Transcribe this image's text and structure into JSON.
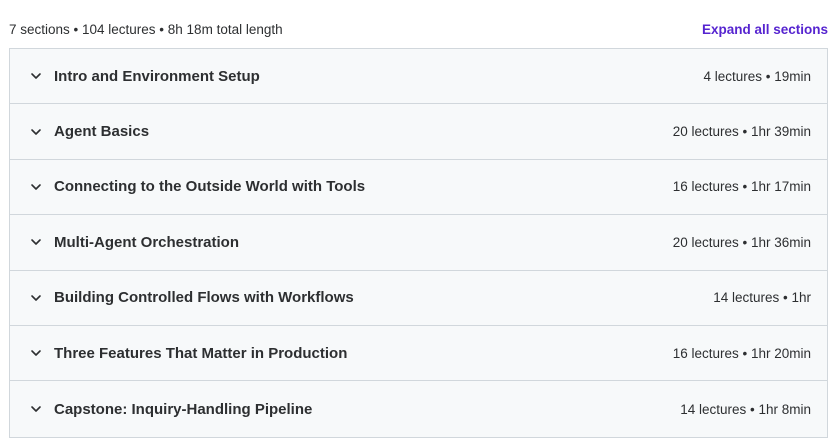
{
  "summary": {
    "text": "7 sections • 104 lectures • 8h 18m total length",
    "expand_label": "Expand all sections"
  },
  "colors": {
    "accent": "#5624d0",
    "section_bg": "#f7f9fa",
    "border": "#d1d7dc",
    "text": "#2d2f31"
  },
  "icons": {
    "section_toggle": "chevron-down-icon"
  },
  "sections": [
    {
      "title": "Intro and Environment Setup",
      "meta": "4 lectures • 19min"
    },
    {
      "title": "Agent Basics",
      "meta": "20 lectures • 1hr 39min"
    },
    {
      "title": "Connecting to the Outside World with Tools",
      "meta": "16 lectures • 1hr 17min"
    },
    {
      "title": "Multi-Agent Orchestration",
      "meta": "20 lectures • 1hr 36min"
    },
    {
      "title": "Building Controlled Flows with Workflows",
      "meta": "14 lectures • 1hr"
    },
    {
      "title": "Three Features That Matter in Production",
      "meta": "16 lectures • 1hr 20min"
    },
    {
      "title": "Capstone: Inquiry-Handling Pipeline",
      "meta": "14 lectures • 1hr 8min"
    }
  ]
}
